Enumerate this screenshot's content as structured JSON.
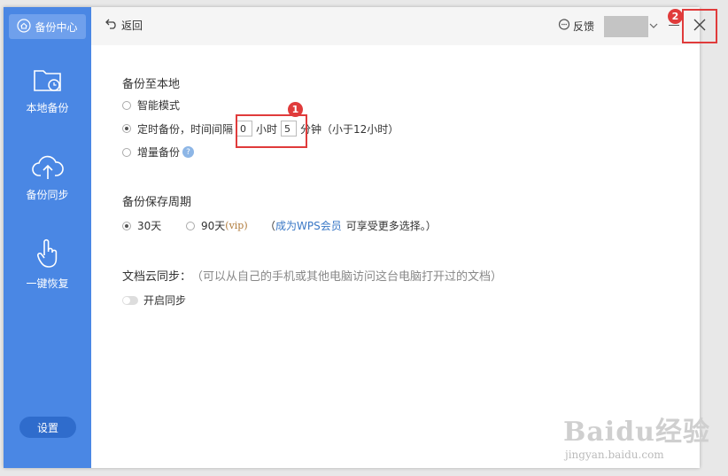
{
  "sidebar": {
    "brand_label": "备份中心",
    "items": [
      {
        "label": "本地备份",
        "icon": "folder-clock-icon"
      },
      {
        "label": "备份同步",
        "icon": "cloud-upload-icon"
      },
      {
        "label": "一键恢复",
        "icon": "hand-pointer-icon"
      }
    ],
    "settings_label": "设置"
  },
  "topbar": {
    "back_label": "返回",
    "feedback_label": "反馈",
    "close_badge": "2"
  },
  "local_backup": {
    "title": "备份至本地",
    "options": {
      "smart_label": "智能模式",
      "timed_prefix": "定时备份，时间间隔",
      "hours_value": "0",
      "hours_unit": "小时",
      "minutes_value": "5",
      "minutes_unit": "分钟（小于12小时）",
      "incremental_label": "增量备份",
      "highlight_badge": "1",
      "help_glyph": "?"
    },
    "selected": "timed"
  },
  "retention": {
    "title": "备份保存周期",
    "opt_30": "30天",
    "opt_90": "90天",
    "vip_tag": "(vip)",
    "note_open": "（",
    "member_link": "成为WPS会员",
    "note_rest": "可享受更多选择。）",
    "selected": "30"
  },
  "cloud_sync": {
    "title": "文档云同步：",
    "description": "（可以从自己的手机或其他电脑访问这台电脑打开过的文档）",
    "toggle_label": "开启同步",
    "enabled": false
  },
  "watermark": {
    "main": "Baidu经验",
    "sub": "jingyan.baidu.com"
  },
  "colors": {
    "sidebar": "#4a87e4",
    "highlight": "#e03b3b",
    "link": "#3a78c6"
  }
}
